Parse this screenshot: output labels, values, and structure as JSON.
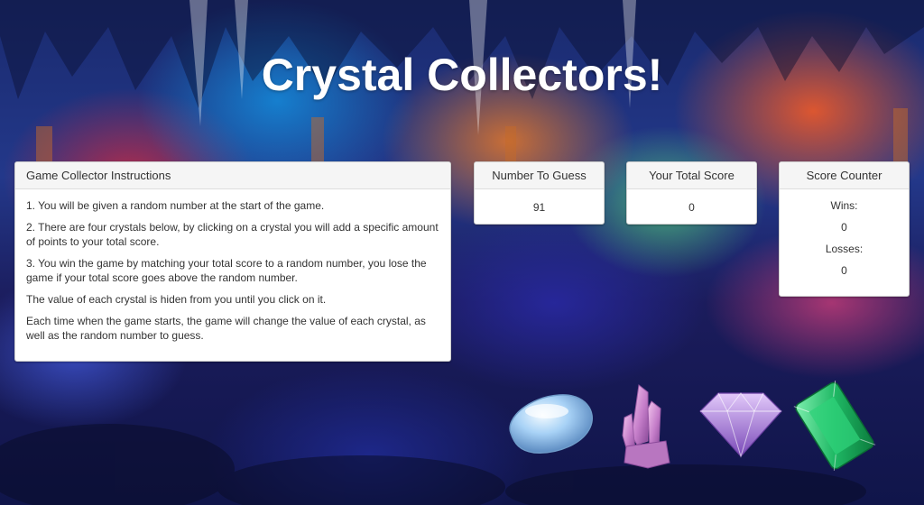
{
  "title": "Crystal Collectors!",
  "instructions": {
    "heading": "Game Collector Instructions",
    "paragraphs": [
      "1. You will be given a random number at the start of the game.",
      "2. There are four crystals below, by clicking on a crystal you will add a specific amount of points to your total score.",
      "3. You win the game by matching your total score to a random number, you lose the game if your total score goes above the random number.",
      "The value of each crystal is hiden from you until you click on it.",
      "Each time when the game starts, the game will change the value of each crystal, as well as the random number to guess."
    ]
  },
  "number_to_guess": {
    "heading": "Number To Guess",
    "value": "91"
  },
  "total_score": {
    "heading": "Your Total Score",
    "value": "0"
  },
  "score_counter": {
    "heading": "Score Counter",
    "wins_label": "Wins:",
    "wins_value": "0",
    "losses_label": "Losses:",
    "losses_value": "0"
  },
  "crystals": [
    {
      "name": "blue-crystal-icon",
      "color": "#9ec9f5"
    },
    {
      "name": "pink-crystal-icon",
      "color": "#d59ad8"
    },
    {
      "name": "purple-crystal-icon",
      "color": "#b58be0"
    },
    {
      "name": "green-crystal-icon",
      "color": "#22c06a"
    }
  ]
}
